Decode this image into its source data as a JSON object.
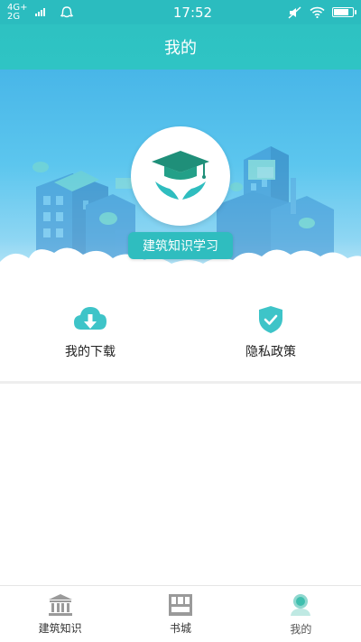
{
  "status_bar": {
    "network_top": "4G+",
    "network_bottom": "2G",
    "time": "17:52",
    "battery_level": 0.85
  },
  "header": {
    "title": "我的"
  },
  "banner": {
    "study_button_label": "建筑知识学习"
  },
  "actions": [
    {
      "label": "我的下载",
      "icon": "cloud-download-icon"
    },
    {
      "label": "隐私政策",
      "icon": "shield-check-icon"
    }
  ],
  "tabbar": {
    "active_index": 2,
    "items": [
      {
        "label": "建筑知识",
        "icon": "building-icon"
      },
      {
        "label": "书城",
        "icon": "bookstore-icon"
      },
      {
        "label": "我的",
        "icon": "profile-icon"
      }
    ]
  },
  "colors": {
    "accent": "#2fbdbf",
    "icon_teal": "#3ec4c8"
  }
}
